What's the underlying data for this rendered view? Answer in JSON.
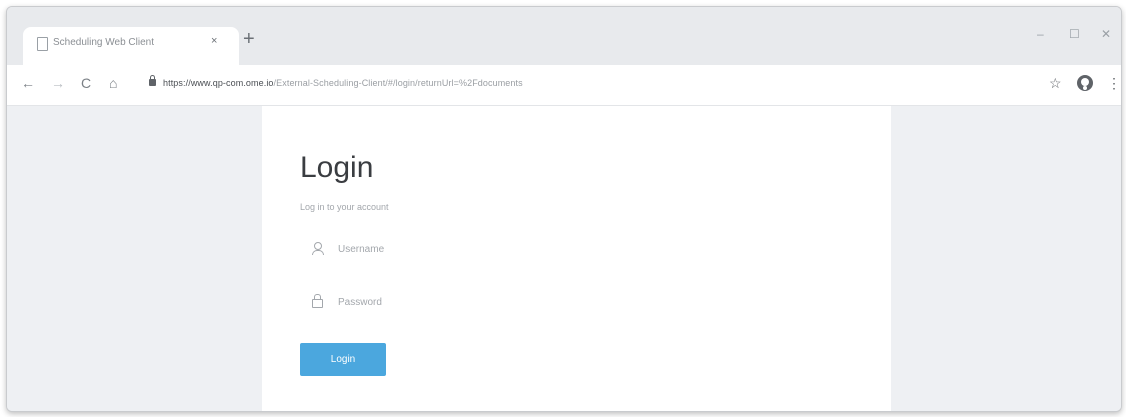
{
  "browser": {
    "tab": {
      "title": "Scheduling Web Client",
      "close_glyph": "×",
      "icon": "document-icon"
    },
    "new_tab_glyph": "+",
    "window_controls": {
      "minimize": "–",
      "maximize": "☐",
      "close": "✕"
    },
    "toolbar": {
      "back": "←",
      "forward": "→",
      "reload": "C",
      "home": "⌂",
      "bookmark": "☆",
      "menu": "⋮"
    },
    "url": {
      "host": "https://www.qp-com.ome.io",
      "path": "/External-Scheduling-Client/#/login/returnUrl=%2Fdocuments"
    }
  },
  "login": {
    "title": "Login",
    "subtitle": "Log in to your account",
    "username": {
      "placeholder": "Username",
      "icon": "user-icon"
    },
    "password": {
      "placeholder": "Password",
      "icon": "lock-icon"
    },
    "button_label": "Login",
    "accent_color": "#4ba7de"
  }
}
